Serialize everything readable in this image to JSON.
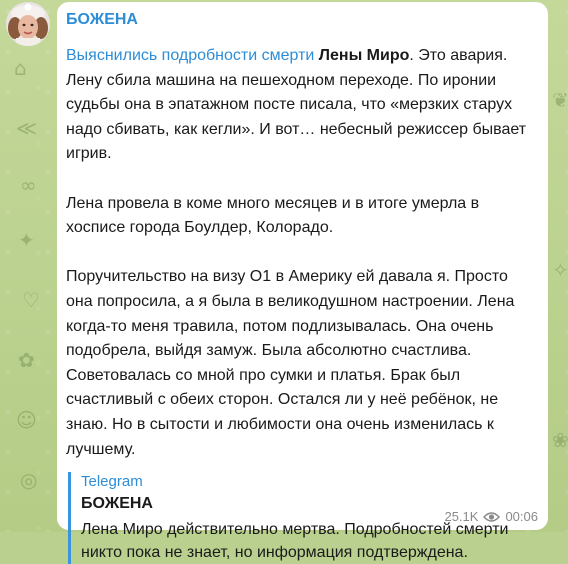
{
  "channel": {
    "name": "БОЖЕНА"
  },
  "message": {
    "link_text": "Выяснились подробности смерти",
    "bold_name": "Лены Миро",
    "p1_rest": ". Это авария. Лену сбила машина на пешеходном переходе. По иронии судьбы она в эпатажном посте писала, что «мерзких старух надо сбивать, как кегли». И вот… небесный режиссер бывает игрив.",
    "p2": "Лена провела в коме много месяцев и в итоге умерла в хосписе города Боулдер, Колорадо.",
    "p3": "Поручительство на визу О1 в Америку ей давала я. Просто она попросила, а я была в великодушном настроении. Лена когда-то меня травила, потом подлизывалась. Она очень подобрела, выйдя замуж. Была абсолютно счастлива. Советовалась со мной про сумки и платья. Брак был счастливый с обеих сторон. Остался ли у неё ребёнок, не знаю. Но в сытости и любимости она очень изменилась к лучшему."
  },
  "quote": {
    "source": "Telegram",
    "author": "БОЖЕНА",
    "text": "Лена Миро действительно мертва. Подробностей смерти никто пока не знает, но информация подтверждена."
  },
  "meta": {
    "views": "25.1K",
    "time": "00:06",
    "views_icon": "eye-icon"
  },
  "colors": {
    "accent": "#2d8dd6",
    "background": "#b9d08f",
    "bubble": "#ffffff"
  }
}
